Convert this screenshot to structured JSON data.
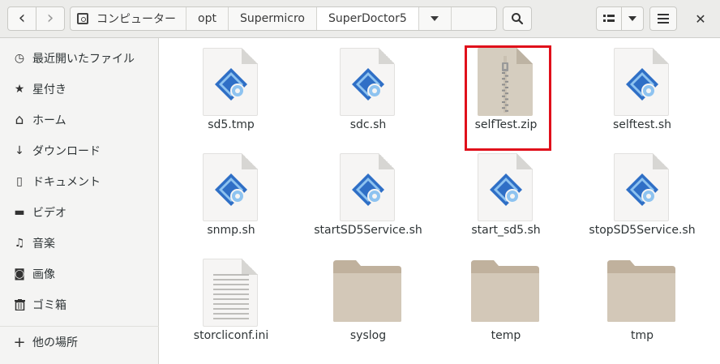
{
  "header": {
    "back_icon": "‹",
    "forward_icon": "›",
    "path": [
      "コンピューター",
      "opt",
      "Supermicro",
      "SuperDoctor5"
    ],
    "search_icon": "⚲",
    "close_icon": "✕"
  },
  "sidebar": {
    "items": [
      {
        "label": "最近開いたファイル",
        "icon": "clock-icon",
        "glyph": "◷"
      },
      {
        "label": "星付き",
        "icon": "star-icon",
        "glyph": "★"
      },
      {
        "label": "ホーム",
        "icon": "home-icon",
        "glyph": "⌂"
      },
      {
        "label": "ダウンロード",
        "icon": "download-icon",
        "glyph": "↓"
      },
      {
        "label": "ドキュメント",
        "icon": "document-icon",
        "glyph": "▯"
      },
      {
        "label": "ビデオ",
        "icon": "video-icon",
        "glyph": "▬"
      },
      {
        "label": "音楽",
        "icon": "music-icon",
        "glyph": "♫"
      },
      {
        "label": "画像",
        "icon": "camera-icon",
        "glyph": "◙"
      },
      {
        "label": "ゴミ箱",
        "icon": "trash-icon",
        "glyph": "🗑"
      },
      {
        "label": "他の場所",
        "icon": "plus-icon",
        "glyph": "+"
      }
    ]
  },
  "files": [
    {
      "name": "sd5.tmp",
      "type": "script"
    },
    {
      "name": "sdc.sh",
      "type": "script"
    },
    {
      "name": "selfTest.zip",
      "type": "zip"
    },
    {
      "name": "selftest.sh",
      "type": "script"
    },
    {
      "name": "snmp.sh",
      "type": "script"
    },
    {
      "name": "startSD5Service.sh",
      "type": "script"
    },
    {
      "name": "start_sd5.sh",
      "type": "script"
    },
    {
      "name": "stopSD5Service.sh",
      "type": "script"
    },
    {
      "name": "storcliconf.ini",
      "type": "text"
    },
    {
      "name": "syslog",
      "type": "folder"
    },
    {
      "name": "temp",
      "type": "folder"
    },
    {
      "name": "tmp",
      "type": "folder"
    }
  ],
  "colors": {
    "script_blue": "#2f6fc6",
    "script_light": "#8ec3f0",
    "folder": "#d3c8b8",
    "folder_tab": "#c0b19d",
    "highlight": "#e0101b"
  }
}
